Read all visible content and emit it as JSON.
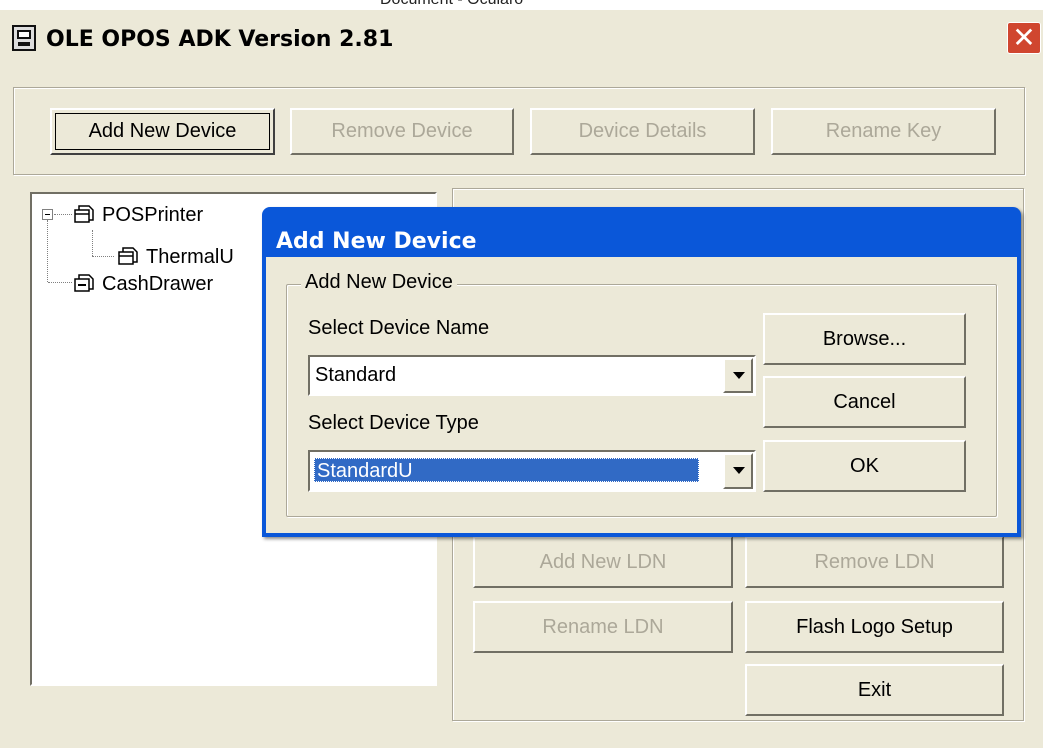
{
  "window": {
    "title": "OLE OPOS ADK Version 2.81",
    "close_glyph": "✕",
    "background_text": "Document - Ocularo"
  },
  "toolbar": {
    "add_new_device": "Add New Device",
    "remove_device": "Remove Device",
    "device_details": "Device Details",
    "rename_key": "Rename Key"
  },
  "tree": {
    "items": [
      {
        "label": "POSPrinter",
        "icon": "printer-device-icon",
        "expanded": true
      },
      {
        "label": "ThermalU",
        "icon": "printer-device-icon"
      },
      {
        "label": "CashDrawer",
        "icon": "cash-drawer-icon"
      }
    ]
  },
  "ldn_buttons": {
    "add_new_ldn": "Add New LDN",
    "remove_ldn": "Remove LDN",
    "rename_ldn": "Rename LDN",
    "flash_logo_setup": "Flash Logo Setup",
    "exit": "Exit"
  },
  "dialog": {
    "title": "Add New Device",
    "group_label": "Add New Device",
    "device_name_label": "Select Device Name",
    "device_name_value": "Standard",
    "device_type_label": "Select Device Type",
    "device_type_value": "StandardU",
    "browse": "Browse...",
    "cancel": "Cancel",
    "ok": "OK"
  },
  "colors": {
    "dialog_title_bar": "#0a57d9",
    "close_button": "#d0462f",
    "selection": "#316ac5",
    "face": "#ece9d8",
    "disabled_text": "#aca899"
  }
}
